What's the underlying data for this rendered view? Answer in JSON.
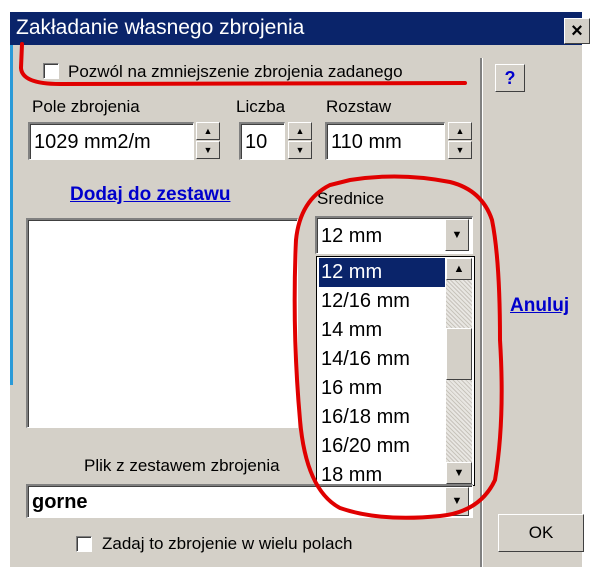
{
  "window": {
    "title": "Zakładanie własnego zbrojenia",
    "close_glyph": "×"
  },
  "options": {
    "allow_reduction_label": "Pozwól na zmniejszenie zbrojenia zadanego",
    "multi_fields_label": "Zadaj to zbrojenie w wielu polach"
  },
  "fields": {
    "pole": {
      "label": "Pole zbrojenia",
      "value": "1029 mm2/m"
    },
    "liczba": {
      "label": "Liczba",
      "value": "10"
    },
    "rozstaw": {
      "label": "Rozstaw",
      "value": "110 mm"
    }
  },
  "add_link": "Dodaj do zestawu",
  "srednice": {
    "label": "Średnice",
    "selected": "12 mm",
    "options": [
      "12 mm",
      "12/16 mm",
      "14 mm",
      "14/16 mm",
      "16 mm",
      "16/18 mm",
      "16/20 mm",
      "18 mm"
    ]
  },
  "file": {
    "label": "Plik z zestawem zbrojenia",
    "value": "gorne"
  },
  "buttons": {
    "help": "?",
    "cancel": "Anuluj",
    "ok": "OK"
  },
  "colors": {
    "titlebar": "#0a246a",
    "face": "#d4d0c8",
    "link": "#0000cc",
    "annotation": "#e00000"
  }
}
